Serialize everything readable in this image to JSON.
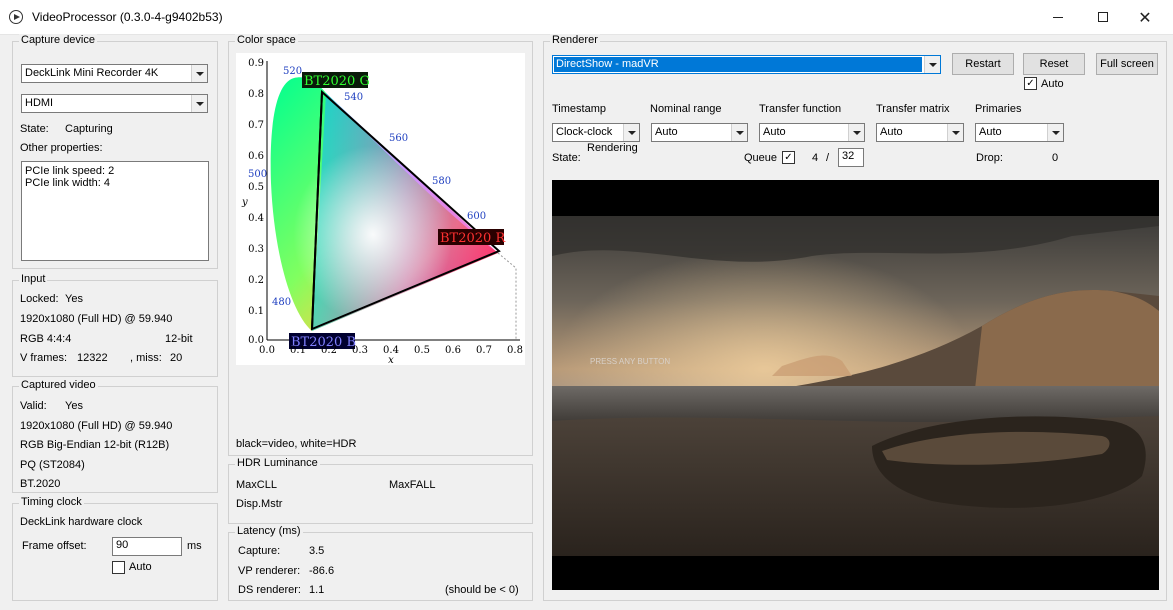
{
  "window": {
    "title": "VideoProcessor (0.3.0-4-g9402b53)",
    "minimize_glyph": "—",
    "maximize_glyph": "□",
    "close_glyph": "✕"
  },
  "capture_device": {
    "title": "Capture device",
    "device": "DeckLink Mini Recorder 4K",
    "input": "HDMI",
    "state_label": "State:",
    "state_value": "Capturing",
    "other_properties_label": "Other properties:",
    "properties": [
      "PCIe link speed: 2",
      "PCIe link width: 4"
    ]
  },
  "input": {
    "title": "Input",
    "locked_label": "Locked:",
    "locked_value": "Yes",
    "resolution": "1920x1080 (Full HD) @ 59.940",
    "format": "RGB 4:4:4",
    "bit_depth": "12-bit",
    "vframes_label": "V frames:",
    "vframes_value": "12322",
    "miss_label": ", miss:",
    "miss_value": "20"
  },
  "captured_video": {
    "title": "Captured video",
    "valid_label": "Valid:",
    "valid_value": "Yes",
    "resolution": "1920x1080 (Full HD) @ 59.940",
    "pixel_format": "RGB Big-Endian 12-bit (R12B)",
    "transfer": "PQ (ST2084)",
    "primaries": "BT.2020"
  },
  "timing_clock": {
    "title": "Timing clock",
    "source": "DeckLink hardware clock",
    "frame_offset_label": "Frame offset:",
    "frame_offset_value": "90",
    "frame_offset_unit": "ms",
    "auto_label": "Auto",
    "auto_checked": false
  },
  "color_space": {
    "title": "Color space",
    "caption": "black=video, white=HDR",
    "labels": {
      "green": "BT2020 G",
      "red": "BT2020 R",
      "blue": "BT2020 B",
      "x_axis": "x",
      "y_axis": "y"
    },
    "wavelengths": [
      "520",
      "540",
      "560",
      "580",
      "600",
      "500",
      "480"
    ],
    "x_ticks": [
      "0.0",
      "0.1",
      "0.2",
      "0.3",
      "0.4",
      "0.5",
      "0.6",
      "0.7",
      "0.8"
    ],
    "y_ticks": [
      "0.9",
      "0.8",
      "0.7",
      "0.6",
      "0.5",
      "0.4",
      "0.3",
      "0.2",
      "0.1",
      "0.0"
    ]
  },
  "hdr_luminance": {
    "title": "HDR Luminance",
    "maxcll_label": "MaxCLL",
    "maxfall_label": "MaxFALL",
    "disp_mstr_label": "Disp.Mstr"
  },
  "latency": {
    "title": "Latency (ms)",
    "capture_label": "Capture:",
    "capture_value": "3.5",
    "vp_label": "VP renderer:",
    "vp_value": "-86.6",
    "ds_label": "DS renderer:",
    "ds_value": "1.1",
    "note": "(should be < 0)"
  },
  "renderer": {
    "title": "Renderer",
    "selected": "DirectShow - madVR",
    "restart_label": "Restart",
    "reset_label": "Reset",
    "fullscreen_label": "Full screen",
    "auto_label": "Auto",
    "auto_checked": true,
    "timestamp_label": "Timestamp",
    "timestamp_value": "Clock-clock",
    "nominal_range_label": "Nominal range",
    "nominal_range_value": "Auto",
    "transfer_function_label": "Transfer function",
    "transfer_function_value": "Auto",
    "transfer_matrix_label": "Transfer matrix",
    "transfer_matrix_value": "Auto",
    "primaries_label": "Primaries",
    "primaries_value": "Auto",
    "state_label": "State:",
    "state_value": "Rendering",
    "queue_label": "Queue",
    "queue_checked": true,
    "queue_value": "4",
    "queue_sep": "/",
    "queue_max": "32",
    "drop_label": "Drop:",
    "drop_value": "0"
  },
  "video": {
    "overlay_text": "PRESS ANY BUTTON"
  }
}
